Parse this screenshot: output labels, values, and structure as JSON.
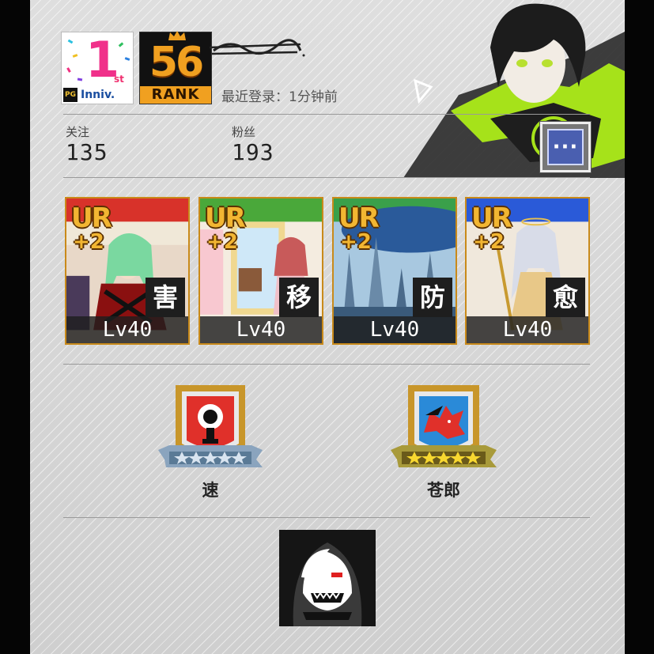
{
  "profile": {
    "anniversary_badge": {
      "number": "1",
      "suffix": "st",
      "brand": "PG",
      "caption": "Inniv."
    },
    "rank": {
      "value": "56",
      "label": "RANK"
    },
    "last_login_label": "最近登录：",
    "last_login_value": "1分钟前",
    "following_label": "关注",
    "following_count": "135",
    "followers_label": "粉丝",
    "followers_count": "193",
    "more_button": "···"
  },
  "cards": [
    {
      "rarity": "UR",
      "plus": "+2",
      "type": "害",
      "level": "Lv40",
      "color": "#d8322a"
    },
    {
      "rarity": "UR",
      "plus": "+2",
      "type": "移",
      "level": "Lv40",
      "color": "#4aa83a"
    },
    {
      "rarity": "UR",
      "plus": "+2",
      "type": "防",
      "level": "Lv40",
      "color": "#3aa04a"
    },
    {
      "rarity": "UR",
      "plus": "+2",
      "type": "愈",
      "level": "Lv40",
      "color": "#2a5ad8"
    }
  ],
  "medals": [
    {
      "name": "速",
      "stars": 5,
      "icon": "stopwatch-icon",
      "stars_color": "silver"
    },
    {
      "name": "苍郎",
      "stars": 5,
      "icon": "wolf-icon",
      "stars_color": "gold"
    }
  ],
  "guild": {
    "icon": "reaper-icon"
  },
  "colors": {
    "accent_gold": "#f0a020",
    "panel_bg": "#d8d8d8",
    "menu_blue": "#4a5fb0"
  }
}
